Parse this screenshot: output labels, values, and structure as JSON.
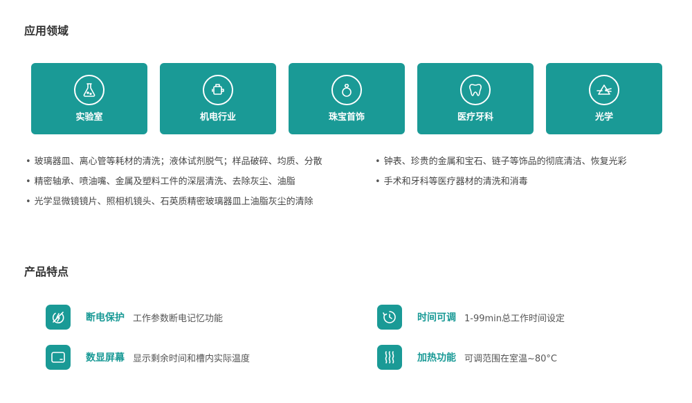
{
  "sections": {
    "applications_title": "应用领域",
    "features_title": "产品特点"
  },
  "cards": [
    {
      "label": "实验室",
      "icon": "flask-icon"
    },
    {
      "label": "机电行业",
      "icon": "motor-icon"
    },
    {
      "label": "珠宝首饰",
      "icon": "diamond-ring-icon"
    },
    {
      "label": "医疗牙科",
      "icon": "tooth-icon"
    },
    {
      "label": "光学",
      "icon": "prism-icon"
    }
  ],
  "bullets_left": [
    "玻璃器皿、离心管等耗材的清洗；液体试剂脱气；样品破碎、均质、分散",
    "精密轴承、喷油嘴、金属及塑料工件的深层清洗、去除灰尘、油脂",
    "光学显微镜镜片、照相机镜头、石英质精密玻璃器皿上油脂灰尘的清除"
  ],
  "bullets_right": [
    "钟表、珍贵的金属和宝石、链子等饰品的彻底清洁、恢复光彩",
    "手术和牙科等医疗器材的清洗和消毒"
  ],
  "features": [
    {
      "name": "断电保护",
      "desc": "工作参数断电记忆功能",
      "icon": "power-protect-icon"
    },
    {
      "name": "时间可调",
      "desc": "1-99min总工作时间设定",
      "icon": "timer-icon"
    },
    {
      "name": "数显屏幕",
      "desc": "显示剩余时间和槽内实际温度",
      "icon": "screen-icon"
    },
    {
      "name": "加热功能",
      "desc": "可调范围在室温~80°C",
      "icon": "heat-icon"
    }
  ],
  "colors": {
    "accent": "#1a9a96",
    "text": "#444444",
    "title": "#333333"
  }
}
